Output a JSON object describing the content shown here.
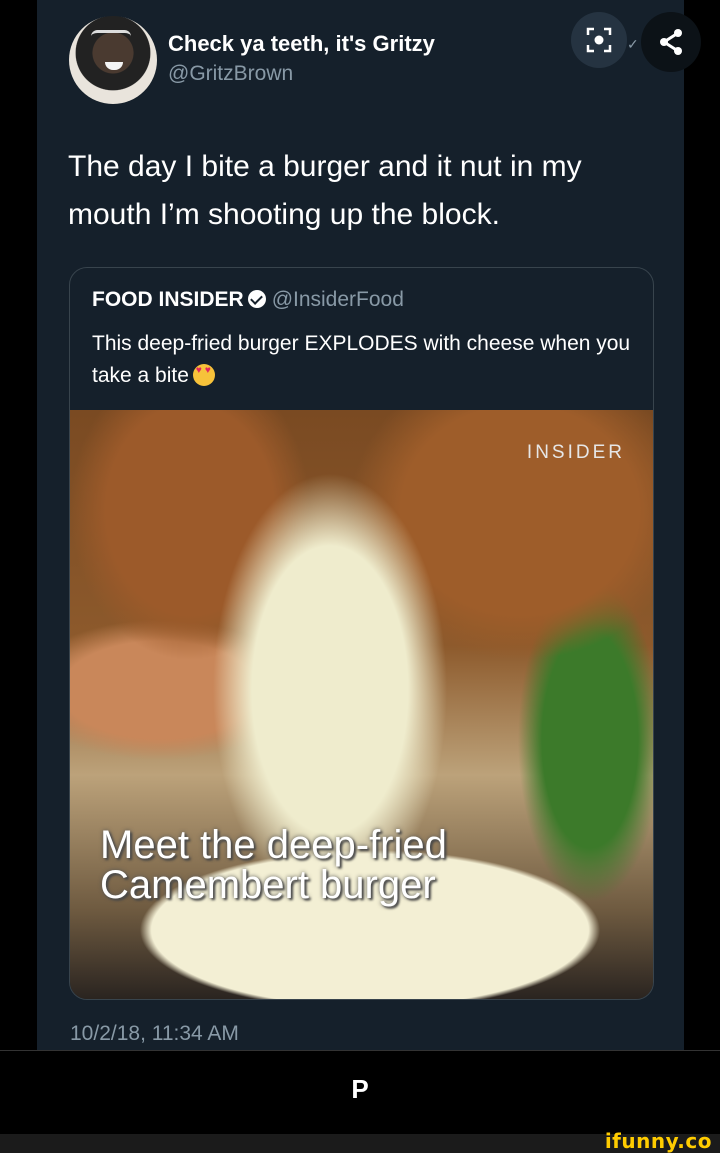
{
  "tweet": {
    "author_name": "Check ya teeth, it's Gritzy",
    "author_handle": "@GritzBrown",
    "text": "The day I bite a burger and it nut in my mouth I’m shooting up the block.",
    "timestamp": "10/2/18, 11:34 AM"
  },
  "quoted_tweet": {
    "author_name": "FOOD INSIDER",
    "author_handle": "@InsiderFood",
    "text": "This deep-fried burger EXPLODES with cheese when you take a bite",
    "media": {
      "watermark": "INSIDER",
      "caption_line1": "Meet the deep-fried",
      "caption_line2": "Camembert burger"
    }
  },
  "bottom": {
    "letter": "P",
    "brand": "ifunny.co"
  },
  "colors": {
    "tweet_bg": "#15202b",
    "secondary_text": "#8899a6",
    "brand": "#ffcc00"
  },
  "icons": [
    "scan-icon",
    "share-icon",
    "verified-badge-icon",
    "heart-eyes-emoji"
  ]
}
